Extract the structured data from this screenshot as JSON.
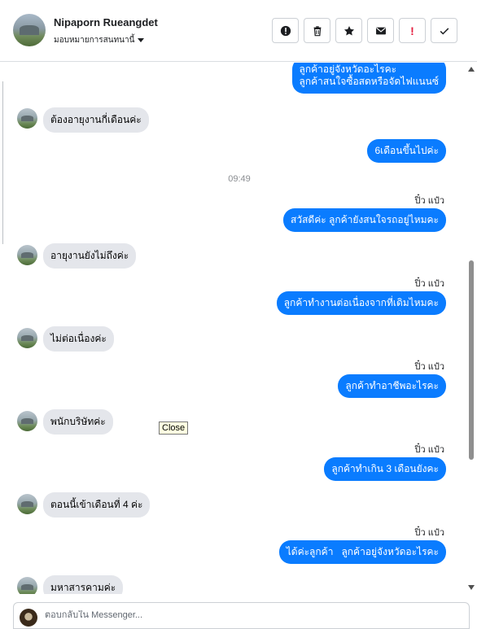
{
  "header": {
    "contact_name": "Nipaporn Rueangdet",
    "assign_label": "มอบหมายการสนทนานี้",
    "tools": [
      {
        "icon": "exclamation-circle-icon",
        "label": "!"
      },
      {
        "icon": "trash-icon",
        "label": ""
      },
      {
        "icon": "star-icon",
        "label": ""
      },
      {
        "icon": "envelope-icon",
        "label": ""
      },
      {
        "icon": "red-exclamation-icon",
        "label": "!"
      },
      {
        "icon": "check-icon",
        "label": ""
      }
    ]
  },
  "thread": {
    "messages": [
      {
        "side": "out",
        "text": "ลูกค้าอยู่จังหวัดอะไรคะ\nลูกค้าสนใจซื้อสดหรือจัดไฟแนนซ์"
      },
      {
        "side": "in",
        "text": "ต้องอายุงานกี่เดือนค่ะ"
      },
      {
        "side": "out",
        "text": "6เดือนขึ้นไปค่ะ"
      },
      {
        "side": "time",
        "text": "09:49"
      },
      {
        "side": "seen",
        "text": "ปิ๋ว แป๋ว"
      },
      {
        "side": "out",
        "text": "สวัสดีค่ะ ลูกค้ายังสนใจรถอยู่ไหมคะ"
      },
      {
        "side": "in",
        "text": "อายุงานยังไม่ถึงค่ะ"
      },
      {
        "side": "seen",
        "text": "ปิ๋ว แป๋ว"
      },
      {
        "side": "out",
        "text": "ลูกค้าทำงานต่อเนื่องจากที่เดิมไหมคะ"
      },
      {
        "side": "in",
        "text": "ไม่ต่อเนื่องค่ะ"
      },
      {
        "side": "seen",
        "text": "ปิ๋ว แป๋ว"
      },
      {
        "side": "out",
        "text": "ลูกค้าทำอาชีพอะไรคะ"
      },
      {
        "side": "in",
        "text": "พนักบริษัทค่ะ"
      },
      {
        "side": "seen",
        "text": "ปิ๋ว แป๋ว"
      },
      {
        "side": "out",
        "text": "ลูกค้าทำเกิน 3 เดือนยังคะ"
      },
      {
        "side": "in",
        "text": "ตอนนี้เข้าเดือนที่ 4 ค่ะ"
      },
      {
        "side": "seen",
        "text": "ปิ๋ว แป๋ว"
      },
      {
        "side": "out",
        "text": "ได้ค่ะลูกค้า   ลูกค้าอยู่จังหวัดอะไรคะ"
      },
      {
        "side": "in",
        "text": "มหาสารคามค่ะ"
      }
    ]
  },
  "tooltip": {
    "text": "Close"
  },
  "composer": {
    "placeholder": "ตอบกลับใน Messenger..."
  },
  "colors": {
    "outgoing_bubble": "#0a7cff",
    "incoming_bubble": "#e4e6eb",
    "alert_red": "#e41e3f"
  }
}
